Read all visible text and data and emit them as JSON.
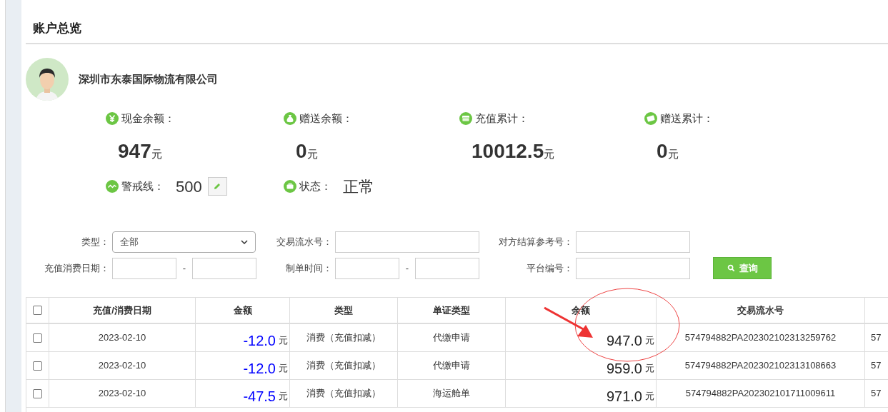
{
  "page_title": "账户总览",
  "company": {
    "name": "深圳市东泰国际物流有限公司"
  },
  "stats": [
    {
      "kind": "yen",
      "label": "现金余额：",
      "value": "947",
      "unit": "元"
    },
    {
      "kind": "moneybag",
      "label": "赠送余额：",
      "value": "0",
      "unit": "元"
    },
    {
      "kind": "bills",
      "label": "充值累计：",
      "value": "10012.5",
      "unit": "元"
    },
    {
      "kind": "ticket",
      "label": "赠送累计：",
      "value": "0",
      "unit": "元"
    }
  ],
  "warning_line": {
    "label": "警戒线：",
    "value": "500"
  },
  "status": {
    "label": "状态：",
    "value": "正常"
  },
  "filters": {
    "type": {
      "label": "类型：",
      "value": "全部"
    },
    "transaction_no": {
      "label": "交易流水号："
    },
    "counterparty_ref": {
      "label": "对方结算参考号："
    },
    "date": {
      "label": "充值消费日期：",
      "separator": "-"
    },
    "created_time": {
      "label": "制单时间：",
      "separator": "-"
    },
    "platform_no": {
      "label": "平台编号："
    },
    "search_button": "查询"
  },
  "table": {
    "select_all_checked": false,
    "columns": [
      "充值/消费日期",
      "金额",
      "类型",
      "单证类型",
      "余额",
      "交易流水号"
    ],
    "rows": [
      {
        "checked": false,
        "date": "2023-02-10",
        "amount": "-12.0",
        "amount_unit": "元",
        "type": "消费（充值扣减）",
        "doc_type": "代缴申请",
        "balance": "947.0",
        "balance_unit": "元",
        "transaction_no": "574794882PA202302102313259762",
        "column_8": "57"
      },
      {
        "checked": false,
        "date": "2023-02-10",
        "amount": "-12.0",
        "amount_unit": "元",
        "type": "消费（充值扣减）",
        "doc_type": "代缴申请",
        "balance": "959.0",
        "balance_unit": "元",
        "transaction_no": "574794882PA202302102313108663",
        "column_8": "57"
      },
      {
        "checked": false,
        "date": "2023-02-10",
        "amount": "-47.5",
        "amount_unit": "元",
        "type": "消费（充值扣减）",
        "doc_type": "海运舱单",
        "balance": "971.0",
        "balance_unit": "元",
        "transaction_no": "574794882PA202302101711009611",
        "column_8": "57"
      }
    ]
  }
}
